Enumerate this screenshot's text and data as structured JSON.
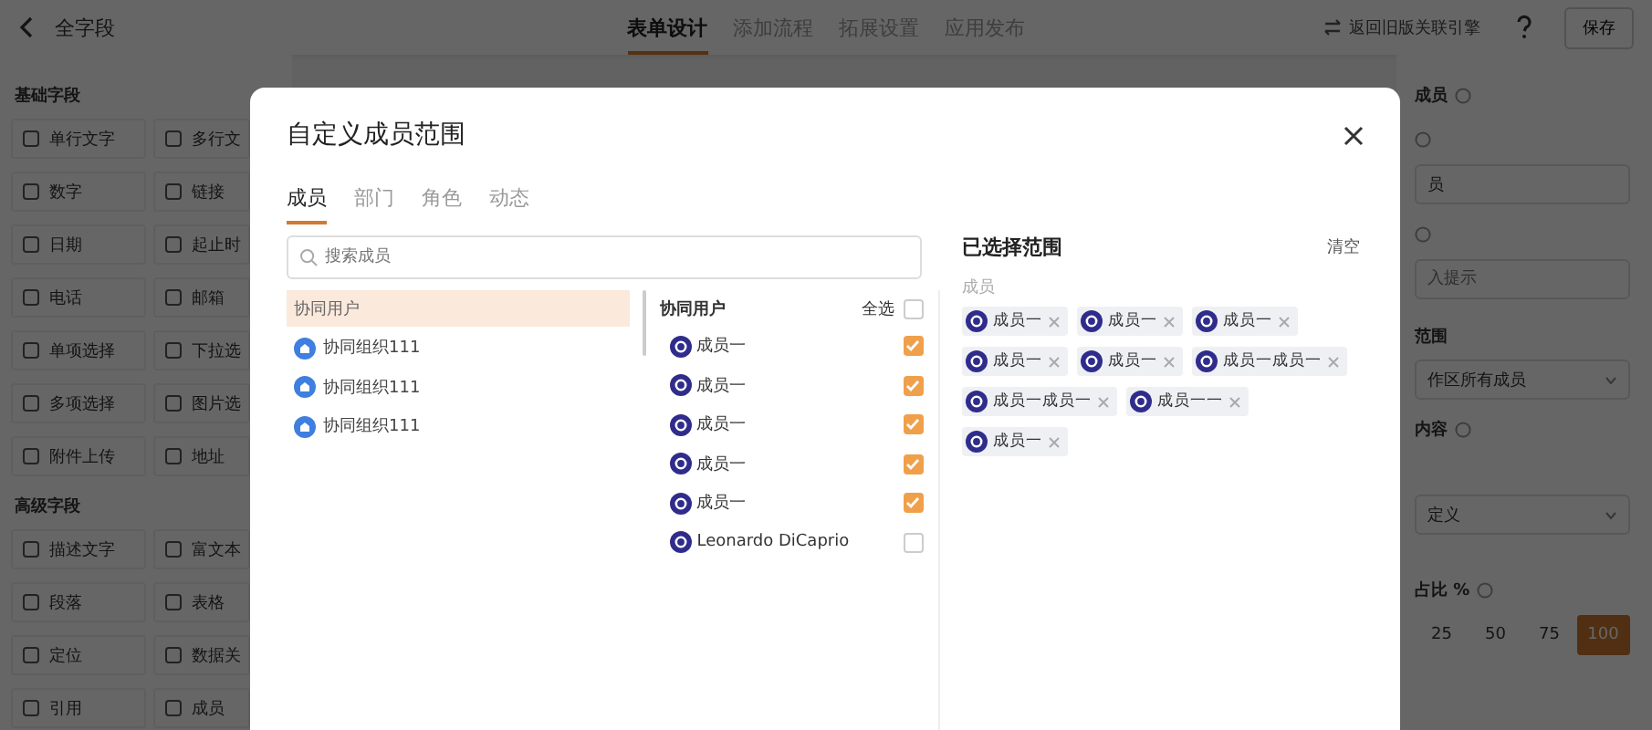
{
  "header": {
    "back_label": "全字段",
    "tabs": [
      {
        "label": "表单设计",
        "selected": true
      },
      {
        "label": "添加流程",
        "selected": false
      },
      {
        "label": "拓展设置",
        "selected": false
      },
      {
        "label": "应用发布",
        "selected": false
      }
    ],
    "switch_link": "返回旧版关联引擎",
    "save_button": "保存"
  },
  "sidebar": {
    "sections": [
      {
        "title": "基础字段",
        "items": [
          "单行文字",
          "多行文",
          "数字",
          "链接",
          "日期",
          "起止时",
          "电话",
          "邮箱",
          "单项选择",
          "下拉选",
          "多项选择",
          "图片选",
          "附件上传",
          "地址"
        ]
      },
      {
        "title": "高级字段",
        "items": [
          "描述文字",
          "富文本",
          "段落",
          "表格",
          "定位",
          "数据关",
          "引用",
          "成员"
        ]
      }
    ]
  },
  "properties": {
    "title": "成员",
    "field_1_value": "员",
    "field_2_placeholder": "入提示",
    "range_label": "范围",
    "range_value": "作区所有成员",
    "content_label": "内容",
    "content_value": "定义",
    "ratio_label": "占比 %",
    "ratio_options": [
      {
        "label": "25",
        "selected": false
      },
      {
        "label": "50",
        "selected": false
      },
      {
        "label": "75",
        "selected": false
      },
      {
        "label": "100",
        "selected": true
      }
    ]
  },
  "dialog": {
    "title": "自定义成员范围",
    "tabs": [
      {
        "label": "成员",
        "selected": true
      },
      {
        "label": "部门",
        "selected": false
      },
      {
        "label": "角色",
        "selected": false
      },
      {
        "label": "动态",
        "selected": false
      }
    ],
    "search": {
      "placeholder": "搜索成员"
    },
    "groups": [
      {
        "label": "协同用户",
        "kind": "group",
        "selected": true
      },
      {
        "label": "协同组织111",
        "kind": "org",
        "selected": false
      },
      {
        "label": "协同组织111",
        "kind": "org",
        "selected": false
      },
      {
        "label": "协同组织111",
        "kind": "org",
        "selected": false
      }
    ],
    "member_list": {
      "title": "协同用户",
      "select_all": "全选",
      "select_all_checked": false,
      "members": [
        {
          "name": "成员一",
          "checked": true
        },
        {
          "name": "成员一",
          "checked": true
        },
        {
          "name": "成员一",
          "checked": true
        },
        {
          "name": "成员一",
          "checked": true
        },
        {
          "name": "成员一",
          "checked": true
        },
        {
          "name": "Leonardo DiCaprio",
          "checked": false
        }
      ]
    },
    "selected_panel": {
      "title": "已选择范围",
      "clear": "清空",
      "category": "成员",
      "tags": [
        "成员一",
        "成员一",
        "成员一",
        "成员一",
        "成员一",
        "成员一成员一",
        "成员一成员一",
        "成员一一",
        "成员一"
      ]
    }
  }
}
